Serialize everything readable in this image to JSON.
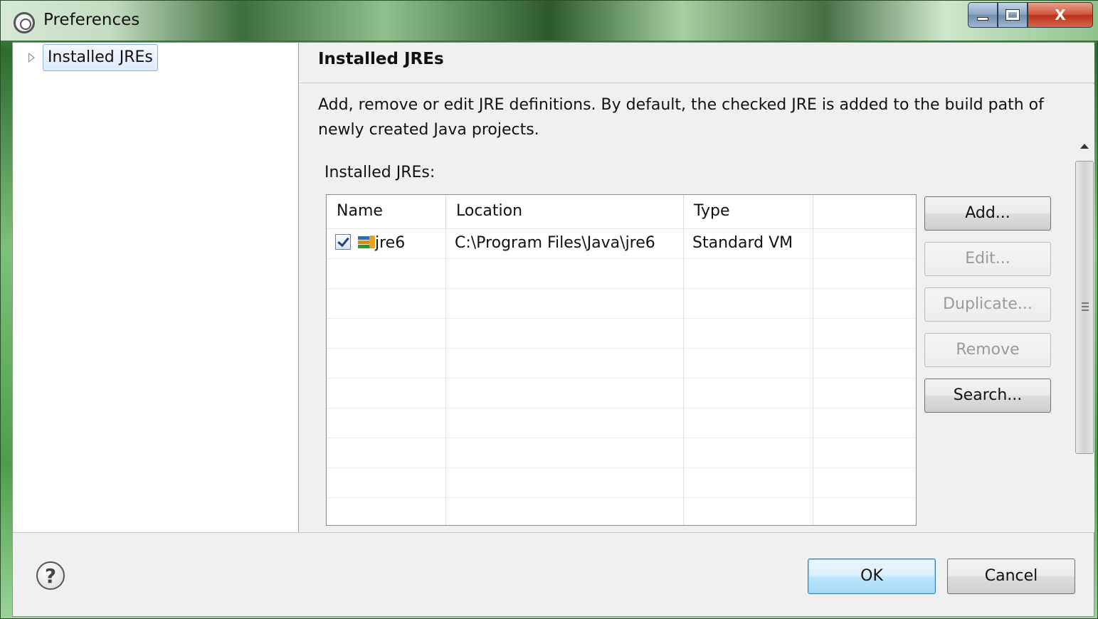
{
  "window": {
    "title": "Preferences"
  },
  "tree": {
    "items": [
      {
        "label": "Installed JREs"
      }
    ]
  },
  "page": {
    "title": "Installed JREs",
    "description": "Add, remove or edit JRE definitions. By default, the checked JRE is added to the build path of newly created Java projects.",
    "list_label": "Installed JREs:"
  },
  "table": {
    "columns": [
      "Name",
      "Location",
      "Type",
      ""
    ],
    "rows": [
      {
        "checked": true,
        "name": "jre6",
        "location": "C:\\Program Files\\Java\\jre6",
        "type": "Standard VM"
      }
    ]
  },
  "buttons": {
    "add": "Add...",
    "edit": "Edit...",
    "duplicate": "Duplicate...",
    "remove": "Remove",
    "search": "Search...",
    "ok": "OK",
    "cancel": "Cancel"
  },
  "icons": {
    "window": "preferences-gear-icon",
    "help": "help-icon",
    "jre": "jre-library-icon"
  }
}
